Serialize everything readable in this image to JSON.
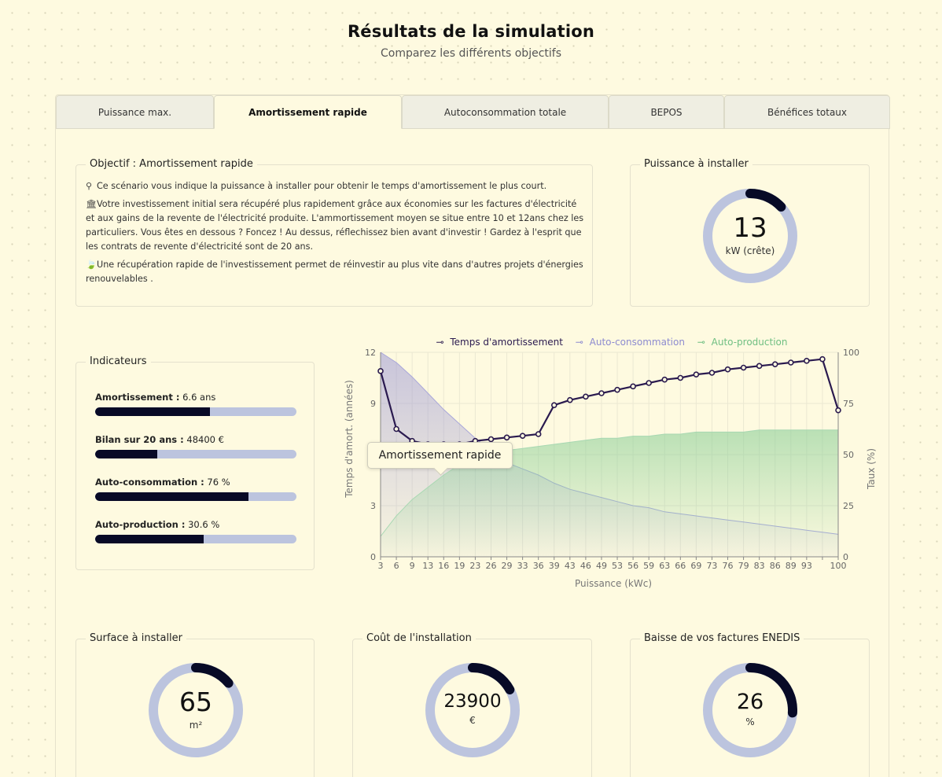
{
  "header": {
    "title": "Résultats de la simulation",
    "subtitle": "Comparez les différents objectifs"
  },
  "tabs": [
    {
      "label": "Puissance max.",
      "active": false
    },
    {
      "label": "Amortissement rapide",
      "active": true
    },
    {
      "label": "Autoconsommation totale",
      "active": false
    },
    {
      "label": "BEPOS",
      "active": false
    },
    {
      "label": "Bénéfices totaux",
      "active": false
    }
  ],
  "objective": {
    "legend": "Objectif : Amortissement rapide",
    "lines": [
      {
        "icon": "lightbulb-icon",
        "glyph": "⚲",
        "text": "Ce scénario vous indique la puissance à installer pour obtenir le temps d'amortissement le plus court."
      },
      {
        "icon": "bank-icon",
        "glyph": "🏛",
        "text": "Votre investissement initial sera récupéré plus rapidement grâce aux économies sur les factures d'électricité et aux gains de la revente de l'électricité produite. L'ammortissement moyen se situe entre 10 et 12ans chez les particuliers. Vous êtes en dessous ? Foncez ! Au dessus, réflechissez bien avant d'investir ! Gardez à l'esprit que les contrats de revente d'électricité sont de 20 ans."
      },
      {
        "icon": "leaf-icon",
        "glyph": "🍃",
        "text": "Une récupération rapide de l'investissement permet de réinvestir au plus vite dans d'autres projets d'énergies renouvelables ."
      }
    ]
  },
  "power": {
    "legend": "Puissance à installer",
    "value": "13",
    "unit": "kW (crête)",
    "fraction": 0.13
  },
  "indicators": {
    "legend": "Indicateurs",
    "items": [
      {
        "label": "Amortissement :",
        "value": "6.6 ans",
        "fraction": 0.57
      },
      {
        "label": "Bilan sur 20 ans :",
        "value": "48400 €",
        "fraction": 0.31
      },
      {
        "label": "Auto-consommation :",
        "value": "76 %",
        "fraction": 0.76
      },
      {
        "label": "Auto-production :",
        "value": "30.6 %",
        "fraction": 0.54
      }
    ]
  },
  "bottom": [
    {
      "legend": "Surface à installer",
      "value": "65",
      "unit": "m²",
      "fraction": 0.14
    },
    {
      "legend": "Coût de l'installation",
      "value": "23900",
      "unit": "€",
      "fraction": 0.17
    },
    {
      "legend": "Baisse de vos factures ENEDIS",
      "value": "26",
      "unit": "%",
      "fraction": 0.26
    }
  ],
  "tooltip": "Amortissement rapide",
  "colors": {
    "dark": "#2a1a4f",
    "purple": "#8d8bd0",
    "green": "#8ccf98",
    "track": "#bcc4de",
    "gauge": "#070a26"
  },
  "chart_data": {
    "type": "line",
    "xlabel": "Puissance (kWc)",
    "ylabel": "Temps d'amort. (années)",
    "y2label": "Taux (%)",
    "ylim": [
      0,
      12
    ],
    "y2lim": [
      0,
      100
    ],
    "yticks": [
      "0",
      "3",
      "9",
      "12"
    ],
    "y2ticks": [
      "0",
      "25",
      "50",
      "75",
      "100"
    ],
    "x": [
      "3",
      "6",
      "9",
      "13",
      "16",
      "19",
      "23",
      "26",
      "29",
      "33",
      "36",
      "39",
      "43",
      "46",
      "49",
      "53",
      "56",
      "59",
      "63",
      "66",
      "69",
      "73",
      "76",
      "79",
      "83",
      "86",
      "89",
      "93",
      "96",
      "100"
    ],
    "xtick_labels": [
      "3",
      "6",
      "9",
      "13",
      "16",
      "19",
      "23",
      "26",
      "29",
      "33",
      "36",
      "39",
      "43",
      "46",
      "49",
      "53",
      "56",
      "59",
      "63",
      "66",
      "69",
      "73",
      "76",
      "79",
      "83",
      "86",
      "89",
      "93",
      "",
      "100"
    ],
    "series": [
      {
        "name": "Temps d'amortissement",
        "axis": "left",
        "values": [
          10.9,
          7.5,
          6.8,
          6.6,
          6.6,
          6.6,
          6.8,
          6.9,
          7.0,
          7.1,
          7.2,
          8.9,
          9.2,
          9.4,
          9.6,
          9.8,
          10.0,
          10.2,
          10.4,
          10.5,
          10.7,
          10.8,
          11.0,
          11.1,
          11.2,
          11.3,
          11.4,
          11.5,
          11.6,
          8.6
        ]
      },
      {
        "name": "Auto-consommation",
        "axis": "right",
        "values": [
          100,
          95,
          88,
          80,
          72,
          65,
          58,
          52,
          46,
          43,
          40,
          36,
          33,
          31,
          29,
          27,
          25,
          24,
          22,
          21,
          20,
          19,
          18,
          17,
          16,
          15,
          14,
          13,
          12,
          11
        ]
      },
      {
        "name": "Auto-production",
        "axis": "right",
        "values": [
          10,
          20,
          28,
          34,
          40,
          45,
          48,
          50,
          52,
          53,
          54,
          55,
          56,
          57,
          58,
          58,
          59,
          59,
          60,
          60,
          61,
          61,
          61,
          61,
          62,
          62,
          62,
          62,
          62,
          62
        ]
      }
    ],
    "legend_position": "top"
  }
}
